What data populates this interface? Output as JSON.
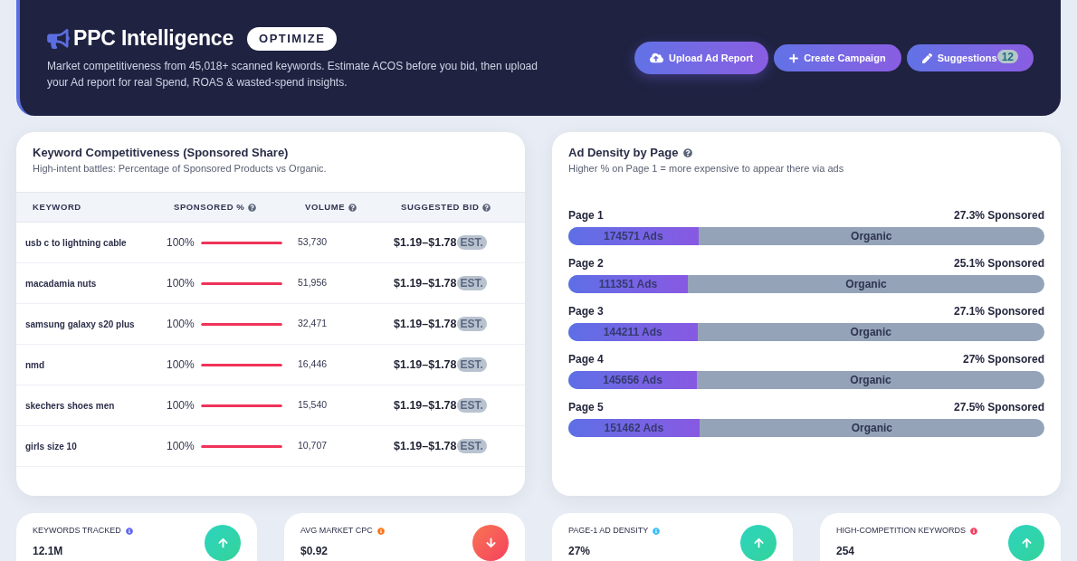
{
  "header": {
    "title": "PPC Intelligence",
    "badge": "OPTIMIZE",
    "description": "Market competitiveness from 45,018+ scanned keywords. Estimate ACOS before you bid, then upload your Ad report for real Spend, ROAS & wasted-spend insights.",
    "buttons": [
      {
        "label": "Upload Ad Report",
        "kind": "upload",
        "hovered": true
      },
      {
        "label": "Create Campaign",
        "kind": "create",
        "hovered": false
      },
      {
        "label": "Suggestions",
        "kind": "suggestions",
        "hovered": false,
        "count": "12"
      }
    ]
  },
  "keyword_table": {
    "title": "Keyword Competitiveness (Sponsored Share)",
    "subtitle": "High-intent battles: Percentage of Sponsored Products vs Organic.",
    "columns": [
      {
        "label": "KEYWORD",
        "help": false
      },
      {
        "label": "SPONSORED %",
        "help": true
      },
      {
        "label": "VOLUME",
        "help": true
      },
      {
        "label": "SUGGESTED BID",
        "help": true
      }
    ],
    "rows": [
      {
        "keyword": "usb c to lightning cable",
        "sponsored": "100%",
        "level": 1,
        "volume": "53,730",
        "bid": "$1.19–$1.78",
        "bid_badge": "EST."
      },
      {
        "keyword": "macadamia nuts",
        "sponsored": "100%",
        "level": 1,
        "volume": "51,956",
        "bid": "$1.19–$1.78",
        "bid_badge": "EST."
      },
      {
        "keyword": "samsung galaxy s20 plus",
        "sponsored": "100%",
        "level": 1,
        "volume": "32,471",
        "bid": "$1.19–$1.78",
        "bid_badge": "EST."
      },
      {
        "keyword": "nmd",
        "sponsored": "100%",
        "level": 1,
        "volume": "16,446",
        "bid": "$1.19–$1.78",
        "bid_badge": "EST."
      },
      {
        "keyword": "skechers shoes men",
        "sponsored": "100%",
        "level": 1,
        "volume": "15,540",
        "bid": "$1.19–$1.78",
        "bid_badge": "EST."
      },
      {
        "keyword": "girls size 10",
        "sponsored": "100%",
        "level": 1,
        "volume": "10,707",
        "bid": "$1.19–$1.78",
        "bid_badge": "EST."
      }
    ]
  },
  "ad_density": {
    "title": "Ad Density by Page",
    "subtitle": "Higher % on Page 1 = more expensive to appear there via ads",
    "pages": [
      {
        "label": "Page 1",
        "share": "27.3% Sponsored",
        "level": 0.273,
        "ads": "174571 Ads",
        "organic": "Organic"
      },
      {
        "label": "Page 2",
        "share": "25.1% Sponsored",
        "level": 0.251,
        "ads": "111351 Ads",
        "organic": "Organic"
      },
      {
        "label": "Page 3",
        "share": "27.1% Sponsored",
        "level": 0.271,
        "ads": "144211 Ads",
        "organic": "Organic"
      },
      {
        "label": "Page 4",
        "share": "27% Sponsored",
        "level": 0.27,
        "ads": "145656 Ads",
        "organic": "Organic"
      },
      {
        "label": "Page 5",
        "share": "27.5% Sponsored",
        "level": 0.275,
        "ads": "151462 Ads",
        "organic": "Organic"
      }
    ]
  },
  "stats": [
    {
      "label": "KEYWORDS TRACKED",
      "color": "#6366f1",
      "value": "12.1M",
      "kind": "up"
    },
    {
      "label": "AVG MARKET CPC",
      "color": "#f97316",
      "value": "$0.92",
      "kind": "down"
    },
    {
      "label": "PAGE-1 AD DENSITY",
      "color": "#38bdf8",
      "value": "27%",
      "kind": "up"
    },
    {
      "label": "HIGH-COMPETITION KEYWORDS",
      "color": "#f43f5e",
      "value": "254",
      "kind": "up"
    }
  ]
}
